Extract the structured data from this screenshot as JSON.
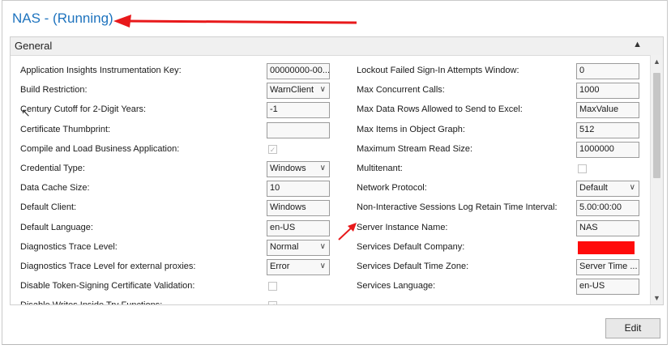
{
  "title": "NAS - (Running)",
  "section": {
    "label": "General"
  },
  "left": [
    {
      "label": "Application Insights Instrumentation Key:",
      "type": "text",
      "value": "00000000-00..."
    },
    {
      "label": "Build Restriction:",
      "type": "select",
      "value": "WarnClient"
    },
    {
      "label": "Century Cutoff for 2-Digit Years:",
      "type": "text",
      "value": "-1"
    },
    {
      "label": "Certificate Thumbprint:",
      "type": "text",
      "value": ""
    },
    {
      "label": "Compile and Load Business Application:",
      "type": "checkbox",
      "checked": true
    },
    {
      "label": "Credential Type:",
      "type": "select",
      "value": "Windows"
    },
    {
      "label": "Data Cache Size:",
      "type": "text",
      "value": "10"
    },
    {
      "label": "Default Client:",
      "type": "text",
      "value": "Windows"
    },
    {
      "label": "Default Language:",
      "type": "text",
      "value": "en-US"
    },
    {
      "label": "Diagnostics Trace Level:",
      "type": "select",
      "value": "Normal"
    },
    {
      "label": "Diagnostics Trace Level for external proxies:",
      "type": "select",
      "value": "Error"
    },
    {
      "label": "Disable Token-Signing Certificate Validation:",
      "type": "checkbox",
      "checked": false
    },
    {
      "label": "Disable Writes Inside Try Functions:",
      "type": "checkbox",
      "checked": true
    }
  ],
  "right": [
    {
      "label": "Lockout Failed Sign-In Attempts Window:",
      "type": "text",
      "value": "0"
    },
    {
      "label": "Max Concurrent Calls:",
      "type": "text",
      "value": "1000"
    },
    {
      "label": "Max Data Rows Allowed to Send to Excel:",
      "type": "text",
      "value": "MaxValue"
    },
    {
      "label": "Max Items in Object Graph:",
      "type": "text",
      "value": "512"
    },
    {
      "label": "Maximum Stream Read Size:",
      "type": "text",
      "value": "1000000"
    },
    {
      "label": "Multitenant:",
      "type": "checkbox",
      "checked": false
    },
    {
      "label": "Network Protocol:",
      "type": "select",
      "value": "Default"
    },
    {
      "label": "Non-Interactive Sessions Log Retain Time Interval:",
      "type": "text",
      "value": "5.00:00:00"
    },
    {
      "label": "Server Instance Name:",
      "type": "text",
      "value": "NAS"
    },
    {
      "label": "Services Default Company:",
      "type": "redacted",
      "value": ""
    },
    {
      "label": "Services Default Time Zone:",
      "type": "text",
      "value": "Server Time ..."
    },
    {
      "label": "Services Language:",
      "type": "text",
      "value": "en-US"
    }
  ],
  "buttons": {
    "edit": "Edit"
  },
  "icons": {
    "collapse": "chevron-up-icon",
    "check": "check-icon",
    "dropdown": "chevron-down-icon"
  },
  "colors": {
    "title": "#1e73be",
    "annotation": "#e8191b",
    "redaction": "#ff0a0a"
  }
}
